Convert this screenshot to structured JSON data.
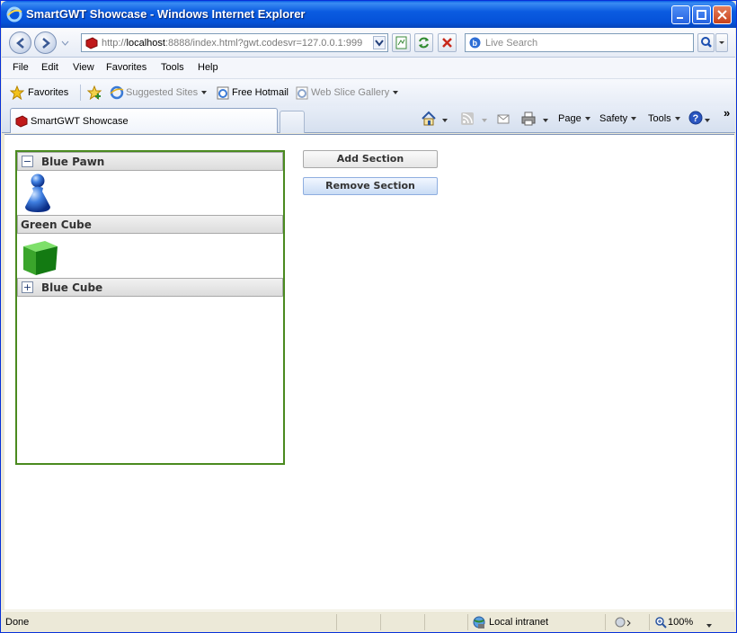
{
  "window": {
    "title": "SmartGWT Showcase - Windows Internet Explorer"
  },
  "address": {
    "url_prefix": "http://",
    "url_host": "localhost",
    "url_rest": ":8888/index.html?gwt.codesvr=127.0.0.1:999",
    "search_placeholder": "Live Search"
  },
  "menu": {
    "items": [
      "File",
      "Edit",
      "View",
      "Favorites",
      "Tools",
      "Help"
    ]
  },
  "favorites": {
    "favorites_label": "Favorites",
    "suggested_sites": "Suggested Sites",
    "free_hotmail": "Free Hotmail",
    "web_slice_gallery": "Web Slice Gallery"
  },
  "tabs": {
    "active_tab": "SmartGWT Showcase"
  },
  "commandbar": {
    "page": "Page",
    "safety": "Safety",
    "tools": "Tools",
    "more": "»"
  },
  "stack": {
    "sections": [
      {
        "title": "Blue Pawn",
        "expanded": true,
        "toggle": "−"
      },
      {
        "title": "Green Cube",
        "expanded": true,
        "toggle": ""
      },
      {
        "title": "Blue Cube",
        "expanded": false,
        "toggle": "+"
      }
    ]
  },
  "buttons": {
    "add_section": "Add Section",
    "remove_section": "Remove Section"
  },
  "status": {
    "text": "Done",
    "zone": "Local intranet",
    "zoom": "100%"
  },
  "colors": {
    "stack_border": "#4a8a1f",
    "title_bar": "#0b5be0"
  }
}
